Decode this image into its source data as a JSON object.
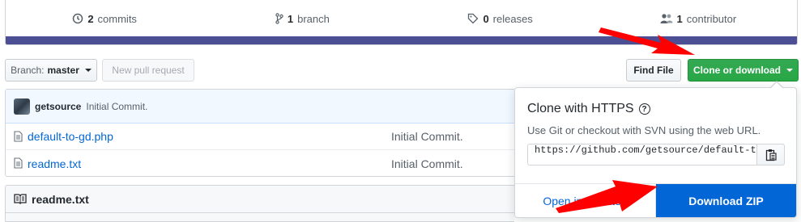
{
  "summary": {
    "commits": {
      "count": "2",
      "label": "commits",
      "icon": "history-icon"
    },
    "branches": {
      "count": "1",
      "label": "branch",
      "icon": "git-branch-icon"
    },
    "releases": {
      "count": "0",
      "label": "releases",
      "icon": "tag-icon"
    },
    "contributors": {
      "count": "1",
      "label": "contributor",
      "icon": "people-icon"
    },
    "bar_color": "#4c4f93"
  },
  "toolbar": {
    "branch_label": "Branch:",
    "branch_value": "master",
    "new_pr_label": "New pull request",
    "find_file_label": "Find File",
    "clone_label": "Clone or download"
  },
  "commit": {
    "author": "getsource",
    "message": "Initial Commit."
  },
  "files": [
    {
      "name": "default-to-gd.php",
      "commit": "Initial Commit."
    },
    {
      "name": "readme.txt",
      "commit": "Initial Commit."
    }
  ],
  "readme": {
    "title": "readme.txt"
  },
  "clone_dropdown": {
    "title": "Clone with HTTPS",
    "help": "?",
    "description": "Use Git or checkout with SVN using the web URL.",
    "url": "https://github.com/getsource/default-to-gd.git",
    "open_desktop_label": "Open in Desktop",
    "download_zip_label": "Download ZIP"
  },
  "colors": {
    "accent_green": "#28a745",
    "link_blue": "#0366d6",
    "annotation_red": "#ff0000"
  }
}
